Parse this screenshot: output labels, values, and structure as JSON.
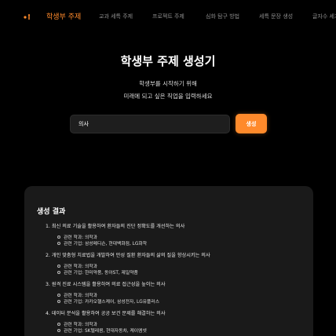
{
  "nav": {
    "items": [
      "학생부 주제",
      "교과 세특 주제",
      "프로젝트 주제",
      "심화 탐구 방법",
      "세특 문장 생성",
      "글자수 세기"
    ],
    "active_index": 0,
    "accent": "#ff8a2b"
  },
  "hero": {
    "title": "학생부 주제 생성기",
    "subtitle_line1": "학생부를 시작하기 위해",
    "subtitle_line2": "미래에 되고 싶은 직업을 입력하세요"
  },
  "form": {
    "job_value": "의사",
    "generate_label": "생성"
  },
  "result": {
    "title": "생성 결과",
    "topics": [
      {
        "text": "1. 최신 의료 기술을 활용하여 환자들의 진단 정확도를 개선하는 의사",
        "major": "관련 학과: 의학과",
        "company": "관련 기업: 삼성메디슨, 현대백화점, LG화학"
      },
      {
        "text": "2. 개인 맞춤형 치료법을 개발하여 만성 질환 환자들의 삶의 질을 향상시키는 의사",
        "major": "관련 학과: 의학과",
        "company": "관련 기업: 한미약품, 동아ST, 제일약품"
      },
      {
        "text": "3. 원격 진료 시스템을 활용하여 의료 접근성을 높이는 의사",
        "major": "관련 학과: 의학과",
        "company": "관련 기업: 카카오헬스케어, 삼성전자, LG유플러스"
      },
      {
        "text": "4. 데이터 분석을 활용하여 공공 보건 문제를 해결하는 의사",
        "major": "관련 학과: 의학과",
        "company": "관련 기업: SK텔레콤, 현대자동차, 케이엠넷"
      }
    ]
  }
}
